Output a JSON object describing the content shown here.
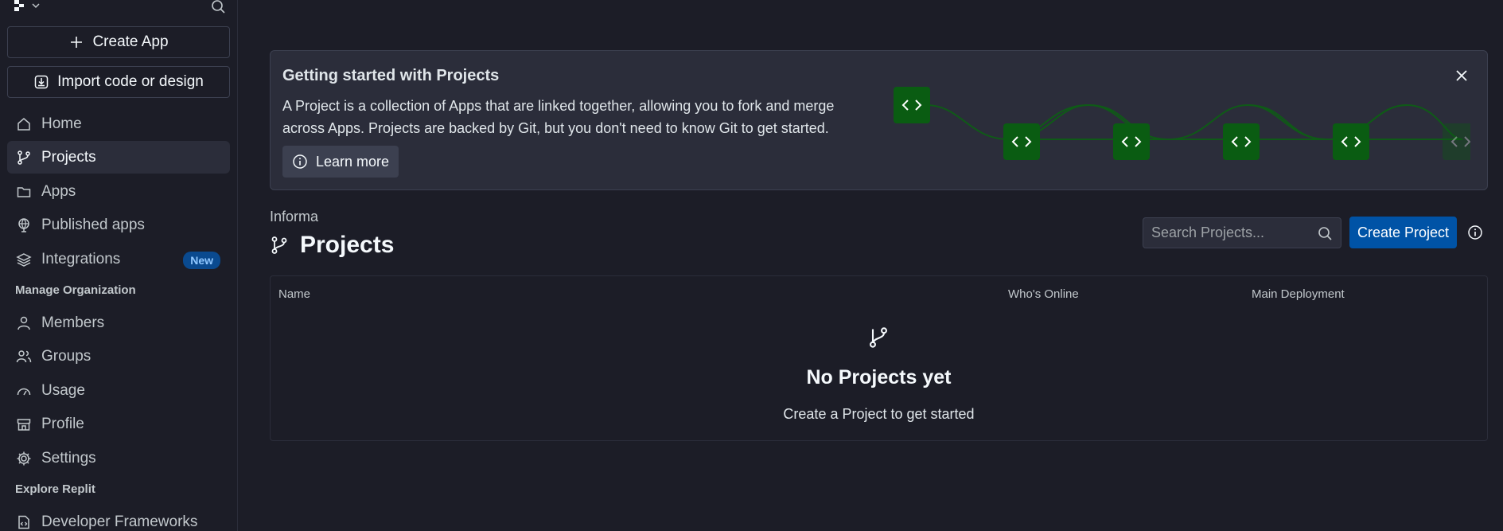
{
  "sidebar": {
    "create_app": "Create App",
    "import": "Import code or design",
    "nav": [
      {
        "label": "Home"
      },
      {
        "label": "Projects"
      },
      {
        "label": "Apps"
      },
      {
        "label": "Published apps"
      },
      {
        "label": "Integrations",
        "badge": "New"
      }
    ],
    "manage_org": "Manage Organization",
    "org_items": [
      {
        "label": "Members"
      },
      {
        "label": "Groups"
      },
      {
        "label": "Usage"
      },
      {
        "label": "Profile"
      },
      {
        "label": "Settings"
      }
    ],
    "explore": "Explore Replit",
    "explore_items": [
      {
        "label": "Developer Frameworks"
      }
    ]
  },
  "banner": {
    "title": "Getting started with Projects",
    "description": "A Project is a collection of Apps that are linked together, allowing you to fork and merge across Apps. Projects are backed by Git, but you don't need to know Git to get started.",
    "learn_more": "Learn more"
  },
  "main": {
    "org_name": "Informa",
    "title": "Projects",
    "search_placeholder": "Search Projects...",
    "create_project": "Create Project",
    "columns": [
      "Name",
      "Who's Online",
      "Main Deployment"
    ],
    "empty_title": "No Projects yet",
    "empty_subtitle": "Create a Project to get started"
  },
  "colors": {
    "background": "#1c1d27",
    "surface": "#2b2d3a",
    "primary": "#0053a6",
    "accent_green": "#0a5c12"
  }
}
